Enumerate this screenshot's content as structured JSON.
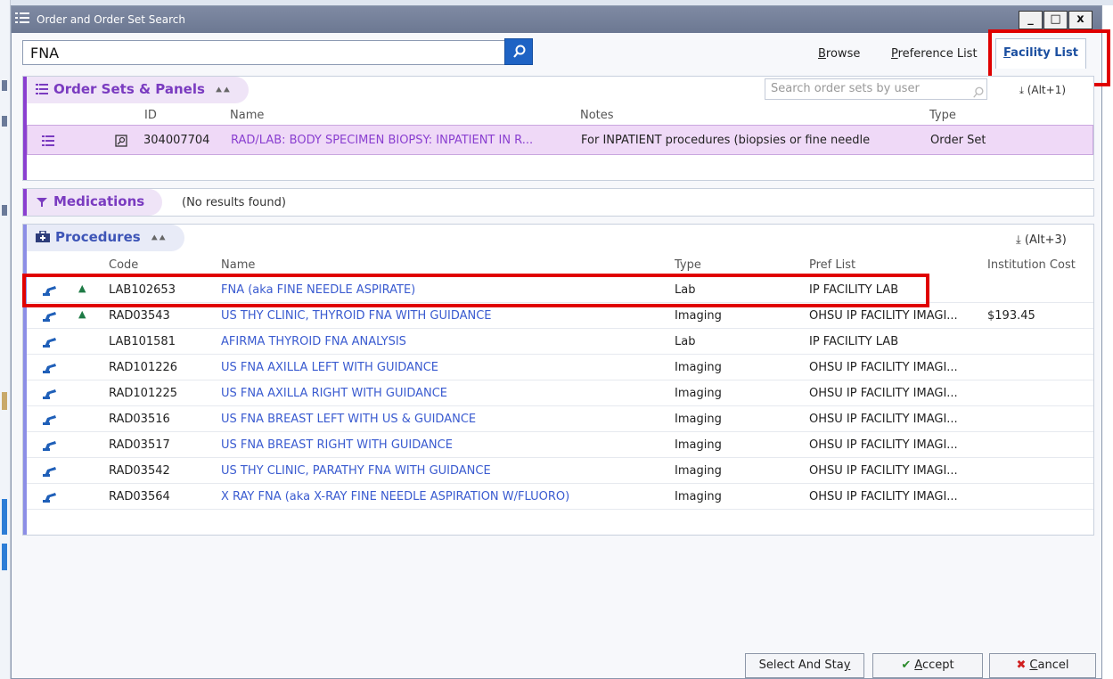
{
  "window": {
    "title": "Order and Order Set Search"
  },
  "search": {
    "value": "FNA"
  },
  "tabs": [
    {
      "label": "Browse",
      "mnemonic": "B",
      "rest": "rowse"
    },
    {
      "label": "Preference List",
      "mnemonic": "P",
      "rest": "reference List"
    },
    {
      "label": "Facility List",
      "mnemonic": "F",
      "rest": "acility List"
    }
  ],
  "order_sets": {
    "title": "Order Sets & Panels",
    "search_placeholder": "Search order sets by user",
    "shortcut": "(Alt+1)",
    "columns": {
      "id": "ID",
      "name": "Name",
      "notes": "Notes",
      "type": "Type"
    },
    "rows": [
      {
        "id": "304007704",
        "name": "RAD/LAB: BODY SPECIMEN BIOPSY: INPATIENT IN R...",
        "notes": "For INPATIENT procedures (biopsies or fine needle",
        "type": "Order Set"
      }
    ]
  },
  "medications": {
    "title": "Medications",
    "status": "(No results found)"
  },
  "procedures": {
    "title": "Procedures",
    "shortcut": "(Alt+3)",
    "columns": {
      "code": "Code",
      "name": "Name",
      "type": "Type",
      "pref_list": "Pref List",
      "cost": "Institution Cost"
    },
    "rows": [
      {
        "code": "LAB102653",
        "name": "FNA (aka FINE NEEDLE ASPIRATE)",
        "type": "Lab",
        "pref_list": "IP FACILITY LAB",
        "cost": ""
      },
      {
        "code": "RAD03543",
        "name": "US THY CLINIC, THYROID FNA WITH GUIDANCE",
        "type": "Imaging",
        "pref_list": "OHSU IP FACILITY IMAGI...",
        "cost": "$193.45"
      },
      {
        "code": "LAB101581",
        "name": "AFIRMA THYROID FNA ANALYSIS",
        "type": "Lab",
        "pref_list": "IP FACILITY LAB",
        "cost": ""
      },
      {
        "code": "RAD101226",
        "name": "US FNA AXILLA LEFT WITH GUIDANCE",
        "type": "Imaging",
        "pref_list": "OHSU IP FACILITY IMAGI...",
        "cost": ""
      },
      {
        "code": "RAD101225",
        "name": "US FNA AXILLA RIGHT WITH GUIDANCE",
        "type": "Imaging",
        "pref_list": "OHSU IP FACILITY IMAGI...",
        "cost": ""
      },
      {
        "code": "RAD03516",
        "name": "US FNA BREAST LEFT WITH US & GUIDANCE",
        "type": "Imaging",
        "pref_list": "OHSU IP FACILITY IMAGI...",
        "cost": ""
      },
      {
        "code": "RAD03517",
        "name": "US FNA BREAST RIGHT WITH GUIDANCE",
        "type": "Imaging",
        "pref_list": "OHSU IP FACILITY IMAGI...",
        "cost": ""
      },
      {
        "code": "RAD03542",
        "name": "US THY CLINIC, PARATHY FNA WITH GUIDANCE",
        "type": "Imaging",
        "pref_list": "OHSU IP FACILITY IMAGI...",
        "cost": ""
      },
      {
        "code": "RAD03564",
        "name": "X RAY FNA (aka X-RAY FINE NEEDLE ASPIRATION W/FLUORO)",
        "type": "Imaging",
        "pref_list": "OHSU IP FACILITY IMAGI...",
        "cost": ""
      }
    ]
  },
  "footer": {
    "select_and_stay": {
      "label": "Select And Sta",
      "mnemonic": "y"
    },
    "accept": {
      "label": "ccept",
      "mnemonic": "A"
    },
    "cancel": {
      "label": "ancel",
      "mnemonic": "C"
    }
  },
  "colors": {
    "accent_purple": "#8a3fd0",
    "accent_blue": "#1e63c4",
    "link": "#3a5bd0",
    "highlight": "#e00000",
    "selected_row": "#efd9f7"
  }
}
